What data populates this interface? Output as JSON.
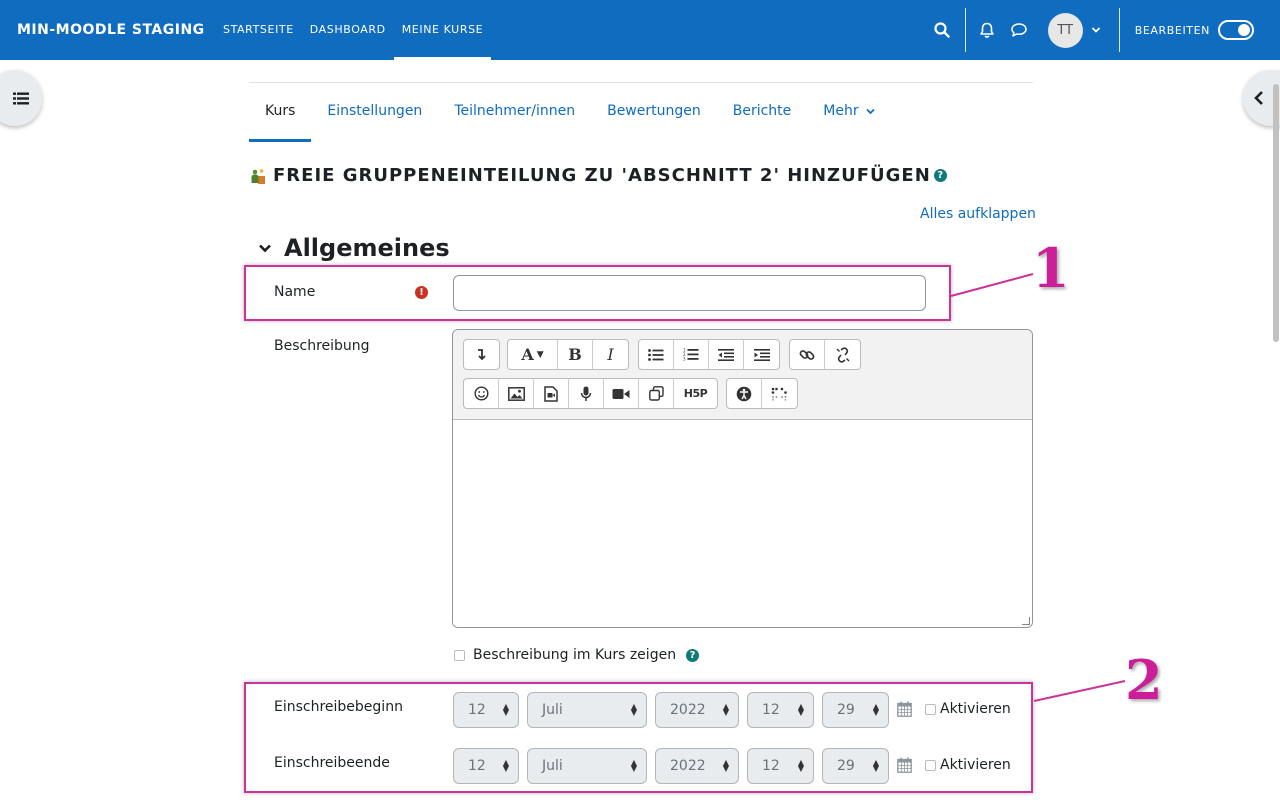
{
  "navbar": {
    "brand": "MIN-MOODLE STAGING",
    "items": [
      {
        "label": "STARTSEITE"
      },
      {
        "label": "DASHBOARD"
      },
      {
        "label": "MEINE KURSE",
        "active": true
      }
    ],
    "user_initials": "TT",
    "edit_label": "BEARBEITEN",
    "edit_mode": true,
    "accent_color": "#0f6cbf"
  },
  "secondary_nav": {
    "tabs": [
      {
        "label": "Kurs",
        "active": true
      },
      {
        "label": "Einstellungen"
      },
      {
        "label": "Teilnehmer/innen"
      },
      {
        "label": "Bewertungen"
      },
      {
        "label": "Berichte"
      },
      {
        "label": "Mehr"
      }
    ]
  },
  "page": {
    "title": "FREIE GRUPPENEINTEILUNG ZU 'ABSCHNITT 2' HINZUFÜGEN",
    "expand_all": "Alles aufklappen",
    "section": "Allgemeines"
  },
  "form": {
    "name_label": "Name",
    "name_value": "",
    "description_label": "Beschreibung",
    "show_description_label": "Beschreibung im Kurs zeigen",
    "enrol_start": {
      "label": "Einschreibebeginn",
      "day": "12",
      "month": "Juli",
      "year": "2022",
      "hour": "12",
      "minute": "29",
      "enable_label": "Aktivieren"
    },
    "enrol_end": {
      "label": "Einschreibeende",
      "day": "12",
      "month": "Juli",
      "year": "2022",
      "hour": "12",
      "minute": "29",
      "enable_label": "Aktivieren"
    }
  },
  "editor_toolbar": {
    "row1": [
      "collapse-icon",
      "font-color-icon",
      "bold-icon",
      "italic-icon",
      "unordered-list-icon",
      "ordered-list-icon",
      "outdent-icon",
      "indent-icon",
      "link-icon",
      "unlink-icon"
    ],
    "row2": [
      "emoji-icon",
      "image-icon",
      "media-icon",
      "record-audio-icon",
      "record-video-icon",
      "manage-files-icon",
      "h5p-icon",
      "accessibility-checker-icon",
      "screenreader-helper-icon"
    ],
    "bold_glyph": "B",
    "italic_glyph": "I",
    "font_glyph": "A",
    "h5p_glyph": "H5P"
  },
  "annotations": {
    "one": "1",
    "two": "2",
    "color": "#cc3399"
  }
}
